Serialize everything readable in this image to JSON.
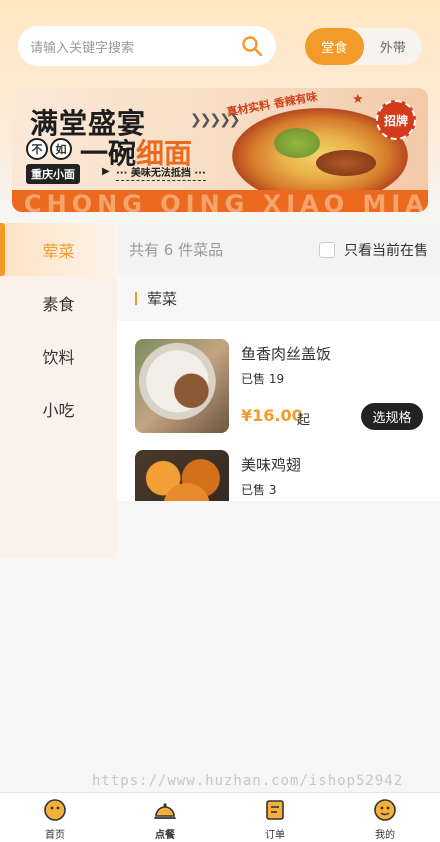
{
  "search": {
    "placeholder": "请输入关键字搜索",
    "icon": "search-icon"
  },
  "mode_toggle": {
    "options": [
      {
        "label": "堂食",
        "active": true
      },
      {
        "label": "外带",
        "active": false
      }
    ]
  },
  "banner": {
    "title_line1": "满堂盛宴",
    "circle1": "不",
    "circle2": "如",
    "title_line2_a": "一碗",
    "title_line2_b": "细面",
    "tag": "重庆小面",
    "subtitle": "··· 美味无法抵挡 ···",
    "slogan": "真材实料 香辣有味",
    "badge": "招牌",
    "english": "CHONG QING XIAO MIAN"
  },
  "categories": [
    {
      "label": "荤菜",
      "active": true
    },
    {
      "label": "素食",
      "active": false
    },
    {
      "label": "饮料",
      "active": false
    },
    {
      "label": "小吃",
      "active": false
    }
  ],
  "list_header": {
    "count_text": "共有 6 件菜品",
    "filter_label": "只看当前在售"
  },
  "section": {
    "title": "荤菜"
  },
  "items": [
    {
      "name": "鱼香肉丝盖饭",
      "sold": "已售 19",
      "price": "¥16.00",
      "unit": "起",
      "button": "选规格"
    },
    {
      "name": "美味鸡翅",
      "sold": "已售 3"
    }
  ],
  "watermark": "https://www.huzhan.com/ishop52942",
  "tabbar": [
    {
      "label": "首页",
      "icon": "home-face-icon"
    },
    {
      "label": "点餐",
      "icon": "order-bell-icon"
    },
    {
      "label": "订单",
      "icon": "orders-list-icon"
    },
    {
      "label": "我的",
      "icon": "profile-face-icon"
    }
  ],
  "colors": {
    "accent": "#f39b2a",
    "dark_button": "#222222",
    "banner_orange": "#ec6a1e"
  }
}
